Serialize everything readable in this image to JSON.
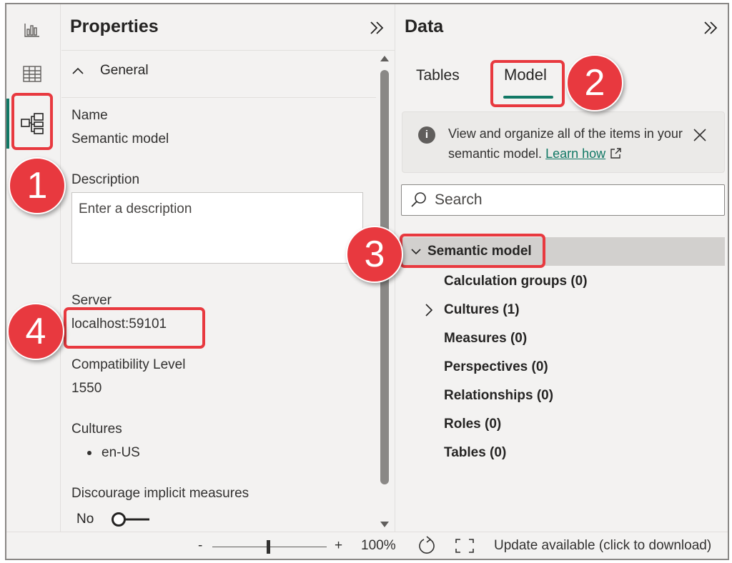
{
  "properties": {
    "title": "Properties",
    "section": "General",
    "name_label": "Name",
    "name_value": "Semantic model",
    "description_label": "Description",
    "description_placeholder": "Enter a description",
    "server_label": "Server",
    "server_value": "localhost:59101",
    "compat_label": "Compatibility Level",
    "compat_value": "1550",
    "cultures_label": "Cultures",
    "cultures_items": [
      "en-US"
    ],
    "implicit_label": "Discourage implicit measures",
    "implicit_value": "No"
  },
  "data_pane": {
    "title": "Data",
    "tabs": [
      {
        "label": "Tables",
        "active": false
      },
      {
        "label": "Model",
        "active": true
      }
    ],
    "info_text": "View and organize all of the items in your semantic model.",
    "info_link": "Learn how",
    "search_placeholder": "Search",
    "tree": {
      "root": "Semantic model",
      "items": [
        "Calculation groups (0)",
        "Cultures (1)",
        "Measures (0)",
        "Perspectives (0)",
        "Relationships (0)",
        "Roles (0)",
        "Tables (0)"
      ]
    }
  },
  "statusbar": {
    "zoom_minus": "-",
    "zoom_plus": "+",
    "zoom_level": "100%",
    "update_text": "Update available (click to download)"
  },
  "annotations": [
    "1",
    "2",
    "3",
    "4"
  ],
  "colors": {
    "accent": "#117865",
    "annotation": "#e8393f",
    "selected_row": "#d2d0ce"
  },
  "icons": {
    "rail": [
      "report-view-icon",
      "table-view-icon",
      "model-view-icon"
    ],
    "collapse": "double-chevron-right-icon",
    "info": "info-icon",
    "close": "close-icon",
    "search": "search-icon",
    "external_link": "external-link-icon",
    "reset": "reset-icon",
    "fit": "fit-to-page-icon"
  }
}
